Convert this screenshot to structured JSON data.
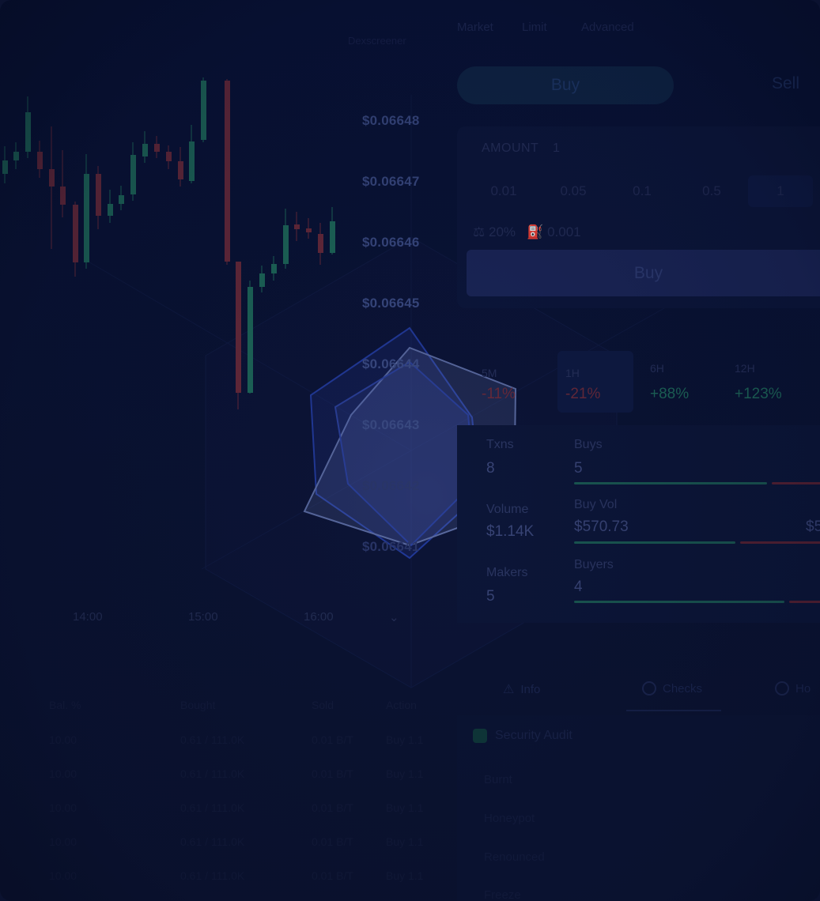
{
  "header": {
    "tabs": [
      "Market",
      "Limit",
      "Advanced"
    ],
    "chart_legend": "Dexscreener"
  },
  "chart": {
    "price_labels": [
      "$0.06648",
      "$0.06647",
      "$0.06646",
      "$0.06645",
      "$0.06644",
      "$0.06643",
      "$0.06642",
      "$0.06641"
    ],
    "time_labels": [
      "14:00",
      "15:00",
      "16:00"
    ],
    "colors": {
      "up": "#1e6a5a",
      "down": "#6a2a3a"
    }
  },
  "trade": {
    "buy_tab": "Buy",
    "sell_tab": "Sell",
    "amount_label": "AMOUNT",
    "amount_value": "1",
    "amount_options": [
      "0.01",
      "0.05",
      "0.1",
      "0.5",
      "1"
    ],
    "slippage": "20%",
    "priority_fee": "0.001",
    "buy_button": "Buy"
  },
  "timeframes": [
    {
      "name": "5M",
      "value": "-11%",
      "dir": "neg"
    },
    {
      "name": "1H",
      "value": "-21%",
      "dir": "neg"
    },
    {
      "name": "6H",
      "value": "+88%",
      "dir": "pos"
    },
    {
      "name": "12H",
      "value": "+123%",
      "dir": "pos"
    }
  ],
  "stats": {
    "txns_label": "Txns",
    "txns_value": "8",
    "buys_label": "Buys",
    "buys_value": "5",
    "volume_label": "Volume",
    "volume_value": "$1.14K",
    "buy_vol_label": "Buy Vol",
    "buy_vol_value": "$570.73",
    "sell_vol_value_partial": "$5",
    "makers_label": "Makers",
    "makers_value": "5",
    "buyers_label": "Buyers",
    "buyers_value": "4",
    "buys_ratio": 0.66,
    "buy_vol_ratio": 0.55,
    "buyers_ratio": 0.72
  },
  "bottom_tabs": [
    "Info",
    "Checks",
    "Ho"
  ],
  "audit": {
    "title": "Security Audit",
    "rows": [
      "Burnt",
      "Honeypot",
      "Renounced",
      "Freeze"
    ]
  },
  "trades_table": {
    "headers": [
      "Bal. %",
      "Bought",
      "Sold",
      "Action"
    ],
    "rows": [
      [
        "10.00",
        "0.61 / 111.0K",
        "0.01 B/T",
        "Buy 1.1"
      ],
      [
        "10.00",
        "0.61 / 111.0K",
        "0.01 B/T",
        "Buy 1.1"
      ],
      [
        "10.00",
        "0.61 / 111.0K",
        "0.01 B/T",
        "Buy 1.1"
      ],
      [
        "10.00",
        "0.61 / 111.0K",
        "0.01 B/T",
        "Buy 1.1"
      ],
      [
        "10.00",
        "0.61 / 111.0K",
        "0.01 B/T",
        "Buy 1.1"
      ]
    ]
  }
}
